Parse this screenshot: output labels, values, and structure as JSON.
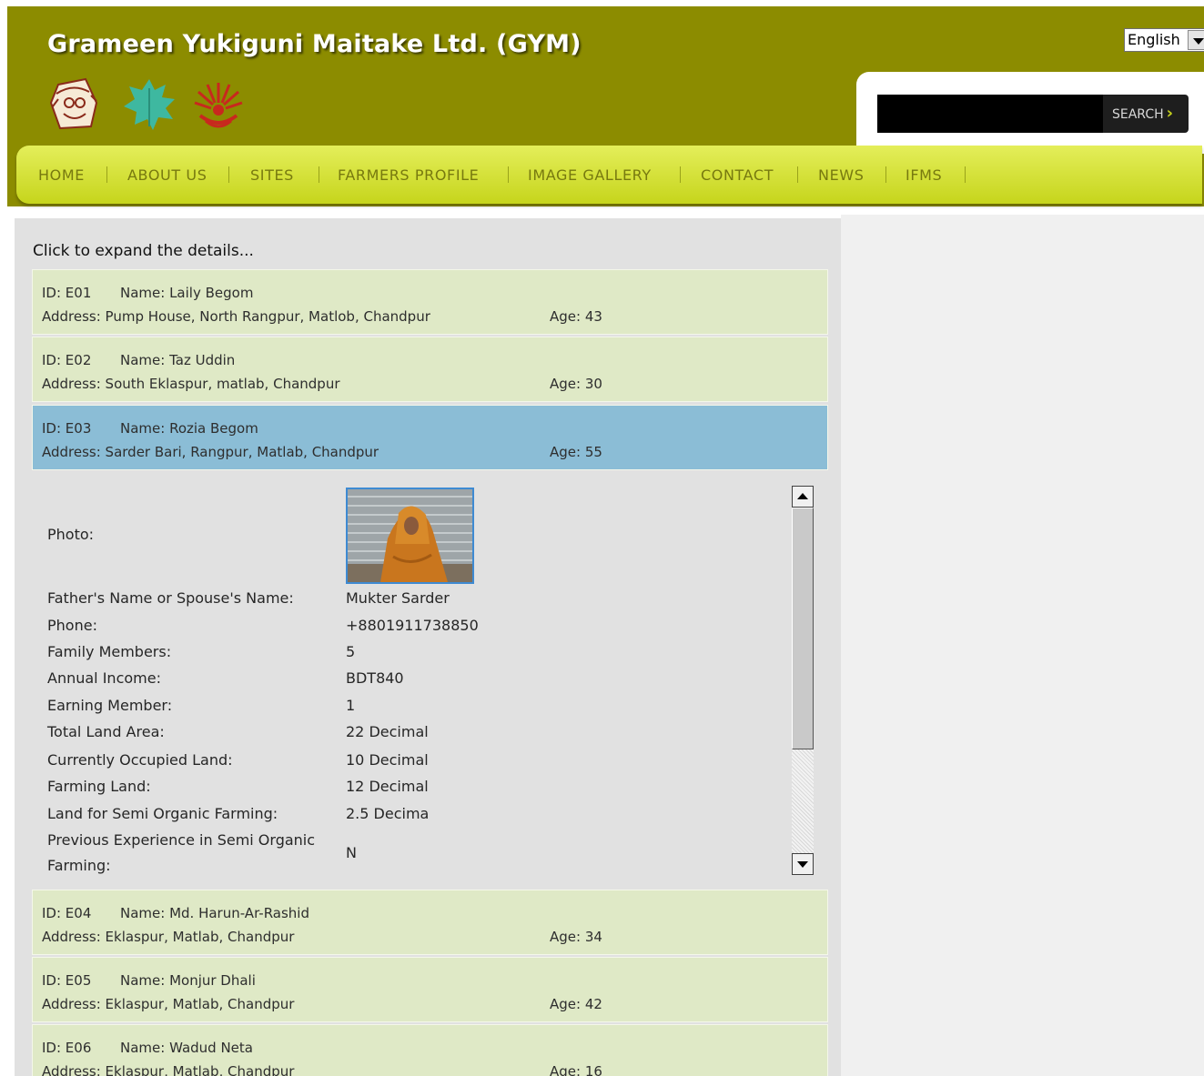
{
  "header": {
    "title": "Grameen Yukiguni Maitake Ltd. (GYM)",
    "language": "English",
    "search": {
      "placeholder": "",
      "button_label": "SEARCH"
    }
  },
  "nav": {
    "items": [
      {
        "label": "HOME"
      },
      {
        "label": "ABOUT US"
      },
      {
        "label": "SITES"
      },
      {
        "label": "FARMERS PROFILE"
      },
      {
        "label": "IMAGE GALLERY"
      },
      {
        "label": "CONTACT"
      },
      {
        "label": "NEWS"
      },
      {
        "label": "IFMS"
      }
    ]
  },
  "main": {
    "intro": "Click to expand the details...",
    "farmers": [
      {
        "id": "ID: E01",
        "name": "Name: Laily Begom",
        "address": "Address: Pump House, North Rangpur, Matlob, Chandpur",
        "age": "Age: 43"
      },
      {
        "id": "ID: E02",
        "name": "Name: Taz Uddin",
        "address": "Address: South Eklaspur, matlab, Chandpur",
        "age": "Age: 30"
      },
      {
        "id": "ID: E03",
        "name": "Name: Rozia Begom",
        "address": "Address: Sarder Bari, Rangpur, Matlab, Chandpur",
        "age": "Age: 55"
      },
      {
        "id": "ID: E04",
        "name": "Name: Md. Harun-Ar-Rashid",
        "address": "Address: Eklaspur, Matlab, Chandpur",
        "age": "Age: 34"
      },
      {
        "id": "ID: E05",
        "name": "Name: Monjur Dhali",
        "address": "Address: Eklaspur, Matlab, Chandpur",
        "age": "Age: 42"
      },
      {
        "id": "ID: E06",
        "name": "Name: Wadud Neta",
        "address": "Address: Eklaspur, Matlab, Chandpur",
        "age": "Age: 16"
      }
    ],
    "details": {
      "photo_label": "Photo:",
      "fields": [
        {
          "label": "Father's Name or Spouse's Name:",
          "value": "Mukter Sarder"
        },
        {
          "label": "Phone:",
          "value": "+8801911738850"
        },
        {
          "label": "Family Members:",
          "value": "5"
        },
        {
          "label": "Annual Income:",
          "value": "BDT840"
        },
        {
          "label": "Earning Member:",
          "value": "1"
        },
        {
          "label": "Total Land Area:",
          "value": "22 Decimal"
        },
        {
          "label": "Currently Occupied Land:",
          "value": "10 Decimal"
        },
        {
          "label": "Farming Land:",
          "value": "12 Decimal"
        },
        {
          "label": "Land for Semi Organic Farming:",
          "value": "2.5 Decima"
        },
        {
          "label_line1": "Previous Experience in Semi Organic",
          "label_line2": "Farming:",
          "value": "N"
        }
      ]
    }
  },
  "colors": {
    "header_bg": "#8c8c00",
    "nav_bg": "#d4e030",
    "row_bg": "#dfe9c6",
    "row_active_bg": "#8bbdd6",
    "photo_border": "#3e8ad2"
  },
  "icons": [
    "grameen-logo-icon",
    "leaf-logo-icon",
    "sun-emblem-logo-icon",
    "search-arrow-icon",
    "dropdown-arrow-icon",
    "scroll-up-arrow-icon",
    "scroll-down-arrow-icon"
  ]
}
